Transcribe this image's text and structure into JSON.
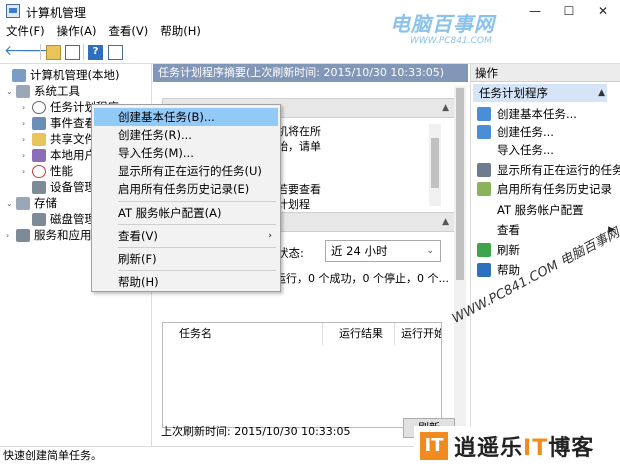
{
  "window": {
    "title": "计算机管理",
    "minimize": "—",
    "maximize": "☐",
    "close": "✕"
  },
  "watermark_top": {
    "title": "电脑百事网",
    "sub": "WWW.PC841.COM"
  },
  "menubar": [
    "文件(F)",
    "操作(A)",
    "查看(V)",
    "帮助(H)"
  ],
  "tree": [
    {
      "label": "计算机管理(本地)",
      "arrow": "",
      "color": "#7a9cc6"
    },
    {
      "label": "系统工具",
      "arrow": "⌄",
      "color": "#9aa7b6"
    },
    {
      "label": "任务计划程序",
      "arrow": "›",
      "color": "#ffffff"
    },
    {
      "label": "事件查看器",
      "arrow": "›",
      "color": "#6a8fb8"
    },
    {
      "label": "共享文件夹",
      "arrow": "›",
      "color": "#e8c45a"
    },
    {
      "label": "本地用户和组",
      "arrow": "›",
      "color": "#8a6fb8"
    },
    {
      "label": "性能",
      "arrow": "›",
      "color": "#cc3b3b"
    },
    {
      "label": "设备管理器",
      "arrow": "",
      "color": "#7d8b99"
    },
    {
      "label": "存储",
      "arrow": "⌄",
      "color": "#9aa7b6"
    },
    {
      "label": "磁盘管理",
      "arrow": "",
      "color": "#7d8b99"
    },
    {
      "label": "服务和应用程序",
      "arrow": "›",
      "color": "#7d8b99"
    }
  ],
  "center": {
    "header": "任务计划程序摘要(上次刷新时间: 2015/10/30 10:33:05)",
    "desc_lines": [
      "程序来创建和管理计算机将在所",
      "行的常见任务。若要开始，请单",
      "的命令。"
    ],
    "desc2_lines": [
      "划程序库的文件夹中。若要查看",
      "执行活操作，请在任务计划程"
    ],
    "status_label": "状态:",
    "status_value": "近 24 小时",
    "summary": "运行，0 个成功，0 个停止，0 个...",
    "columns": [
      "任务名",
      "运行结果",
      "运行开始时"
    ],
    "footer_time": "上次刷新时间: 2015/10/30 10:33:05",
    "refresh_button": "刷新"
  },
  "actions": {
    "title": "操作",
    "section": "任务计划程序",
    "items": [
      {
        "label": "创建基本任务...",
        "color": "#4a8fd6",
        "submenu": false
      },
      {
        "label": "创建任务...",
        "color": "#4a8fd6",
        "submenu": false
      },
      {
        "label": "导入任务...",
        "color": "",
        "submenu": false
      },
      {
        "label": "显示所有正在运行的任务",
        "color": "#6d7d8e",
        "submenu": false
      },
      {
        "label": "启用所有任务历史记录",
        "color": "#8bb35a",
        "submenu": false
      },
      {
        "label": "AT 服务帐户配置",
        "color": "",
        "submenu": false
      },
      {
        "label": "查看",
        "color": "",
        "submenu": true
      },
      {
        "label": "刷新",
        "color": "#3fa34d",
        "submenu": false
      },
      {
        "label": "帮助",
        "color": "#2f6fbf",
        "submenu": false
      }
    ]
  },
  "context_menu": [
    {
      "label": "创建基本任务(B)...",
      "highlight": true,
      "submenu": false
    },
    {
      "label": "创建任务(R)...",
      "highlight": false,
      "submenu": false
    },
    {
      "label": "导入任务(M)...",
      "highlight": false,
      "submenu": false
    },
    {
      "label": "显示所有正在运行的任务(U)",
      "highlight": false,
      "submenu": false
    },
    {
      "label": "启用所有任务历史记录(E)",
      "highlight": false,
      "submenu": false
    },
    {
      "label": "AT 服务帐户配置(A)",
      "highlight": false,
      "submenu": false
    },
    {
      "label": "查看(V)",
      "highlight": false,
      "submenu": true
    },
    {
      "label": "刷新(F)",
      "highlight": false,
      "submenu": false
    },
    {
      "label": "帮助(H)",
      "highlight": false,
      "submenu": false
    }
  ],
  "statusbar": "快速创建简单任务。",
  "watermark_diag": "WWW.PC841.COM 电脑百事网",
  "brand": {
    "badge": "IT",
    "text_pre": "逍遥乐",
    "text_it": "IT",
    "text_post": "博客"
  }
}
